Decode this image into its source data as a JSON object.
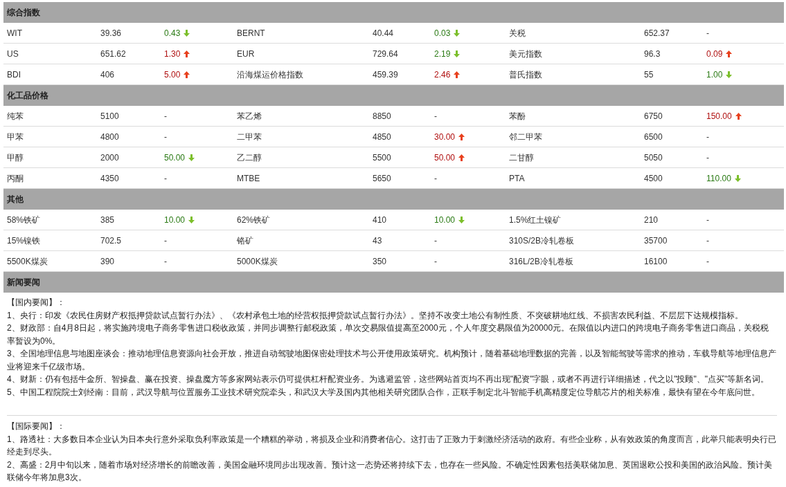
{
  "sections": [
    {
      "title": "综合指数",
      "rows": [
        [
          {
            "name": "WIT",
            "price": "39.36",
            "change": "0.43",
            "kind": "down"
          },
          {
            "name": "BERNT",
            "price": "40.44",
            "change": "0.03",
            "kind": "down"
          },
          {
            "name": "关税",
            "price": "652.37",
            "change": "-",
            "kind": "none"
          }
        ],
        [
          {
            "name": "US",
            "price": "651.62",
            "change": "1.30",
            "kind": "up"
          },
          {
            "name": "EUR",
            "price": "729.64",
            "change": "2.19",
            "kind": "down"
          },
          {
            "name": "美元指数",
            "price": "96.3",
            "change": "0.09",
            "kind": "up"
          }
        ],
        [
          {
            "name": "BDI",
            "price": "406",
            "change": "5.00",
            "kind": "up"
          },
          {
            "name": "沿海煤运价格指数",
            "price": "459.39",
            "change": "2.46",
            "kind": "up"
          },
          {
            "name": "普氏指数",
            "price": "55",
            "change": "1.00",
            "kind": "down"
          }
        ]
      ]
    },
    {
      "title": "化工品价格",
      "rows": [
        [
          {
            "name": "纯苯",
            "price": "5100",
            "change": "-",
            "kind": "none"
          },
          {
            "name": "苯乙烯",
            "price": "8850",
            "change": "-",
            "kind": "none"
          },
          {
            "name": "苯酚",
            "price": "6750",
            "change": "150.00",
            "kind": "up"
          }
        ],
        [
          {
            "name": "甲苯",
            "price": "4800",
            "change": "-",
            "kind": "none"
          },
          {
            "name": "二甲苯",
            "price": "4850",
            "change": "30.00",
            "kind": "up"
          },
          {
            "name": "邻二甲苯",
            "price": "6500",
            "change": "-",
            "kind": "none"
          }
        ],
        [
          {
            "name": "甲醇",
            "price": "2000",
            "change": "50.00",
            "kind": "down"
          },
          {
            "name": "乙二醇",
            "price": "5500",
            "change": "50.00",
            "kind": "up"
          },
          {
            "name": "二甘醇",
            "price": "5050",
            "change": "-",
            "kind": "none"
          }
        ],
        [
          {
            "name": "丙酮",
            "price": "4350",
            "change": "-",
            "kind": "none"
          },
          {
            "name": "MTBE",
            "price": "5650",
            "change": "-",
            "kind": "none"
          },
          {
            "name": "PTA",
            "price": "4500",
            "change": "110.00",
            "kind": "down"
          }
        ]
      ]
    },
    {
      "title": "其他",
      "rows": [
        [
          {
            "name": "58%铁矿",
            "price": "385",
            "change": "10.00",
            "kind": "down"
          },
          {
            "name": "62%铁矿",
            "price": "410",
            "change": "10.00",
            "kind": "down"
          },
          {
            "name": "1.5%红土镍矿",
            "price": "210",
            "change": "-",
            "kind": "none"
          }
        ],
        [
          {
            "name": "15%镍铁",
            "price": "702.5",
            "change": "-",
            "kind": "none"
          },
          {
            "name": "铬矿",
            "price": "43",
            "change": "-",
            "kind": "none"
          },
          {
            "name": "310S/2B冷轧卷板",
            "price": "35700",
            "change": "-",
            "kind": "none"
          }
        ],
        [
          {
            "name": "5500K煤炭",
            "price": "390",
            "change": "-",
            "kind": "none"
          },
          {
            "name": "5000K煤炭",
            "price": "350",
            "change": "-",
            "kind": "none"
          },
          {
            "name": "316L/2B冷轧卷板",
            "price": "16100",
            "change": "-",
            "kind": "none"
          }
        ]
      ]
    }
  ],
  "news": {
    "title": "新闻要闻",
    "groups": [
      {
        "heading": "【国内要闻】：",
        "items": [
          "1、央行：印发《农民住房财产权抵押贷款试点暂行办法》、《农村承包土地的经营权抵押贷款试点暂行办法》。坚持不改变土地公有制性质、不突破耕地红线、不损害农民利益、不层层下达规模指标。",
          "2、财政部：自4月8日起，将实施跨境电子商务零售进口税收政策，并同步调整行邮税政策，单次交易限值提高至2000元，个人年度交易限值为20000元。在限值以内进口的跨境电子商务零售进口商品，关税税率暂设为0%。",
          "3、全国地理信息与地图座谈会：推动地理信息资源向社会开放，推进自动驾驶地图保密处理技术与公开使用政策研究。机构预计，随着基础地理数据的完善，以及智能驾驶等需求的推动，车载导航等地理信息产业将迎来千亿级市场。",
          "4、财新：仍有包括牛金所、智操盘、赢在投资、操盘魔方等多家网站表示仍可提供杠杆配资业务。为逃避监管，这些网站首页均不再出现\"配资\"字眼，或者不再进行详细描述，代之以\"投顾\"、\"点买\"等新名词。",
          "5、中国工程院院士刘经南：目前，武汉导航与位置服务工业技术研究院牵头，和武汉大学及国内其他相关研究团队合作，正联手制定北斗智能手机高精度定位导航芯片的相关标准，最快有望在今年底问世。"
        ]
      },
      {
        "heading": "【国际要闻】：",
        "items": [
          "1、路透社：大多数日本企业认为日本央行意外采取负利率政策是一个糟糕的举动，将损及企业和消费者信心。这打击了正致力于刺激经济活动的政府。有些企业称，从有效政策的角度而言，此举只能表明央行已经走到尽头。",
          "2、高盛：2月中旬以来，随着市场对经济增长的前瞻改善，美国金融环境同步出现改善。预计这一态势还将持续下去，也存在一些风险。不确定性因素包括美联储加息、英国退欧公投和美国的政治风险。预计美联储今年将加息3次。"
        ]
      }
    ]
  }
}
